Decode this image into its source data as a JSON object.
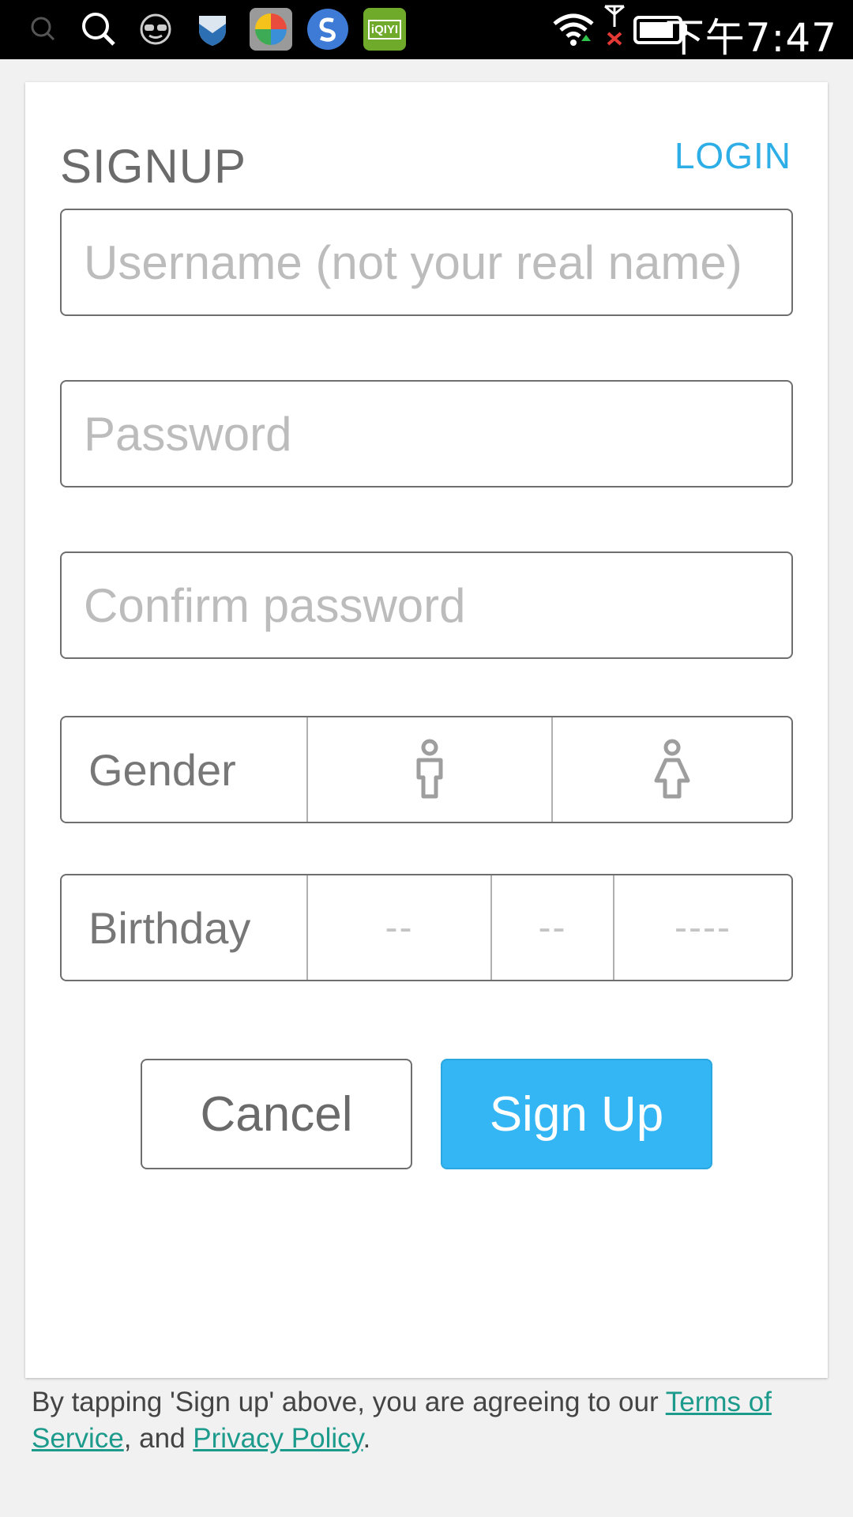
{
  "status_bar": {
    "time": "下午7:47",
    "icons": [
      "search-small-icon",
      "search-icon",
      "sunglasses-icon",
      "shield-icon",
      "colorful-app-icon",
      "blue-s-app-icon",
      "iqiyi-app-icon",
      "wifi-icon",
      "antenna-no-signal-icon",
      "battery-icon"
    ],
    "iqiyi_label": "iQIYI"
  },
  "form": {
    "title": "SIGNUP",
    "login_link": "LOGIN",
    "username_placeholder": "Username (not your real name)",
    "password_placeholder": "Password",
    "confirm_placeholder": "Confirm password",
    "gender_label": "Gender",
    "birthday_label": "Birthday",
    "birthday_month": "--",
    "birthday_day": "--",
    "birthday_year": "----",
    "cancel_label": "Cancel",
    "signup_label": "Sign Up"
  },
  "terms": {
    "prefix": "By tapping 'Sign up' above, you are agreeing to our ",
    "tos_link": "Terms of Service",
    "middle": ", and ",
    "privacy_link": "Privacy Policy",
    "suffix": "."
  },
  "colors": {
    "accent": "#34b6f5",
    "link": "#2eaee6",
    "terms_link": "#1c9b8c"
  }
}
